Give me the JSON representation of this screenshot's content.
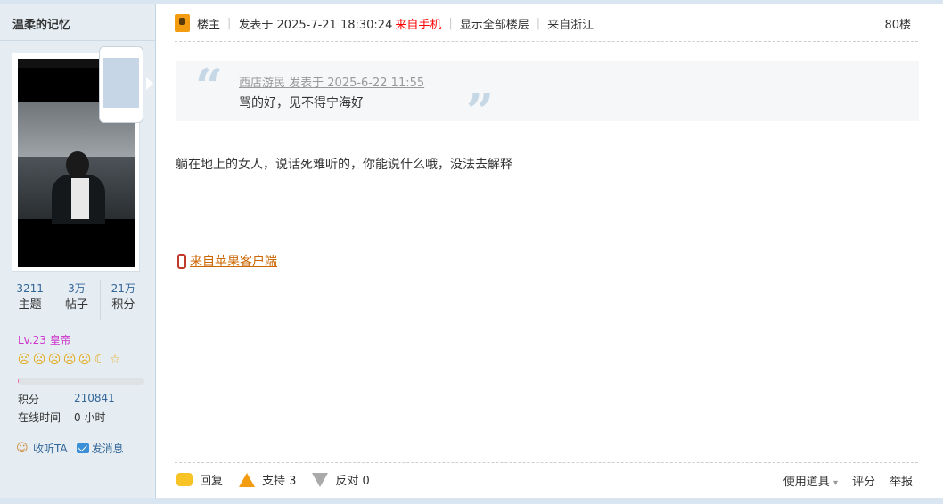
{
  "user": {
    "name": "温柔的记忆",
    "stats": [
      {
        "num": "3211",
        "label": "主题"
      },
      {
        "num": "3万",
        "label": "帖子"
      },
      {
        "num": "21万",
        "label": "积分"
      }
    ],
    "level": "Lv.23 皇帝",
    "level_icons": [
      "sun-icon",
      "sun-icon",
      "sun-icon",
      "sun-icon",
      "sun-icon",
      "moon-icon",
      "star-icon"
    ],
    "level_progress_fraction": 0.01,
    "points_label": "积分",
    "points_value": "210841",
    "online_label": "在线时间",
    "online_value": "0 小时",
    "listen_label": "收听TA",
    "message_label": "发消息"
  },
  "post": {
    "host_label": "楼主",
    "posted_at": "发表于 2025-7-21 18:30:24",
    "from_mobile": "来自手机",
    "show_all": "显示全部楼层",
    "location": "来自浙江",
    "floor": "80楼",
    "quote_author": "西店游民 发表于 2025-6-22 11:55",
    "quote_text": "骂的好，见不得宁海好",
    "body": "躺在地上的女人，说话死难听的，你能说什么哦，没法去解释",
    "client_link": "来自苹果客户端",
    "reply_label": "回复",
    "support_label": "支持 3",
    "oppose_label": "反对 0",
    "tools_label": "使用道具",
    "rate_label": "评分",
    "report_label": "举报"
  },
  "colors": {
    "accent": "#336699",
    "level": "#cc33cc",
    "client": "#cc6600"
  }
}
